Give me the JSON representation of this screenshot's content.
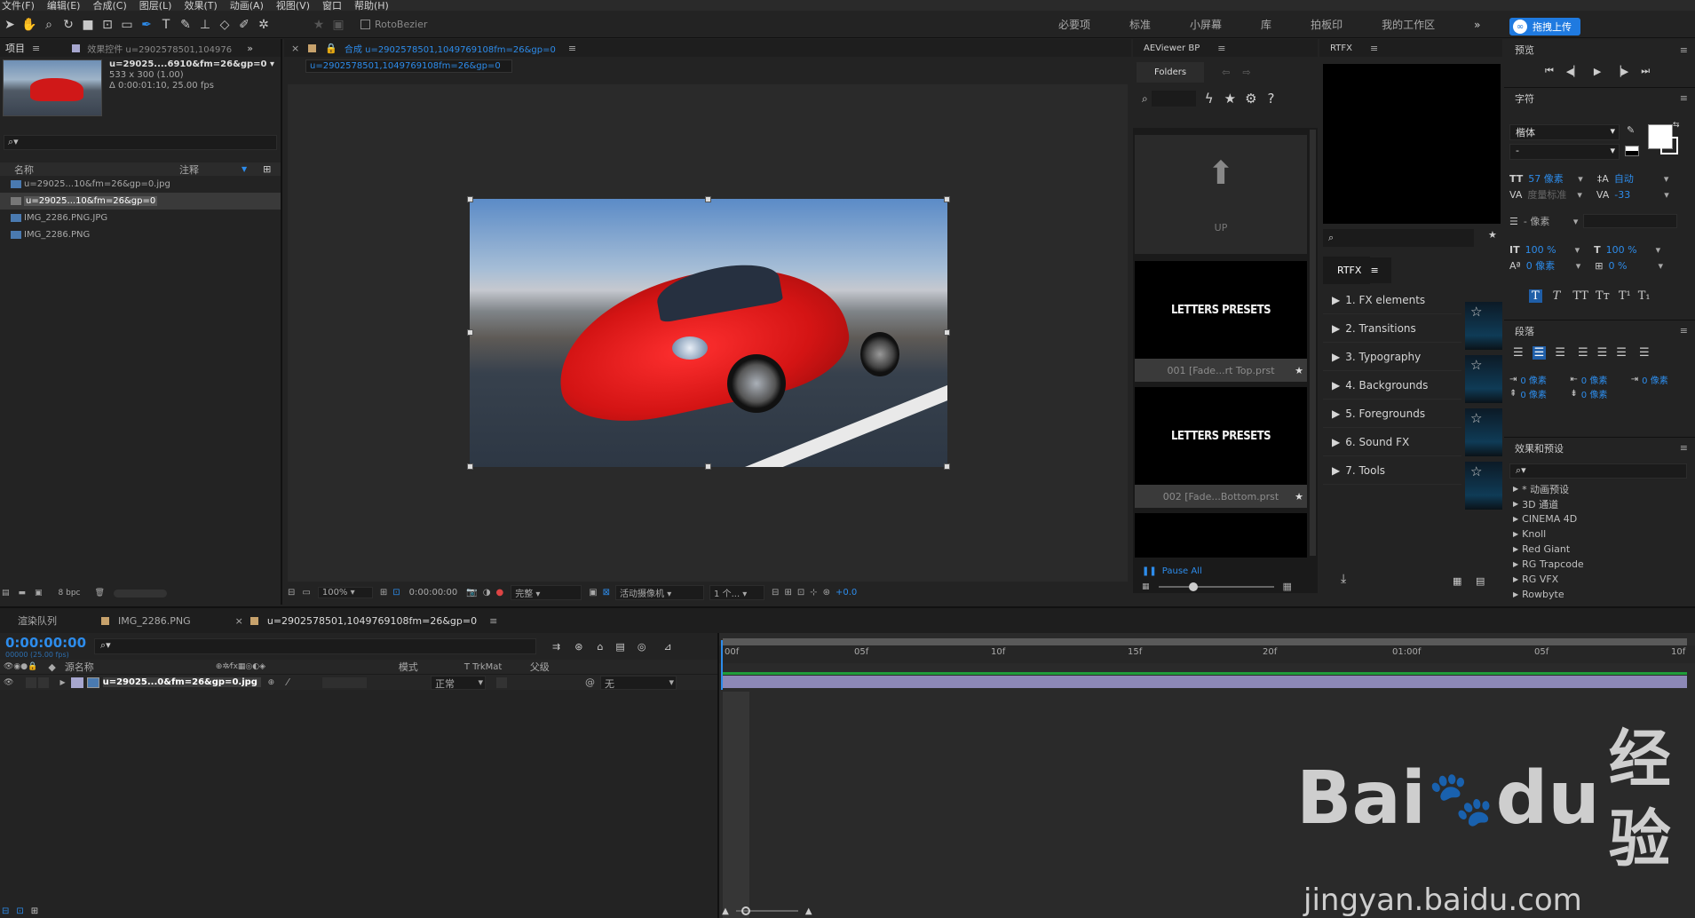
{
  "menu": [
    "文件(F)",
    "编辑(E)",
    "合成(C)",
    "图层(L)",
    "效果(T)",
    "动画(A)",
    "视图(V)",
    "窗口",
    "帮助(H)"
  ],
  "toolbar": {
    "rotobezier": "RotoBezier"
  },
  "workspaces": [
    "必要项",
    "标准",
    "小屏幕",
    "库",
    "拍板印",
    "我的工作区"
  ],
  "upload_badge": "拖拽上传",
  "project_panel": {
    "tab": "项目",
    "effects_tab": "效果控件 u=2902578501,104976",
    "selected_name": "u=29025....6910&fm=26&gp=0 ▾",
    "size": "533 x 300 (1.00)",
    "duration": "Δ 0:00:01:10, 25.00 fps",
    "col_name": "名称",
    "col_comment": "注释",
    "items": [
      "u=29025...10&fm=26&gp=0.jpg",
      "u=29025...10&fm=26&gp=0",
      "IMG_2286.PNG.JPG",
      "IMG_2286.PNG"
    ],
    "bpc": "8 bpc"
  },
  "comp_panel": {
    "tab": "合成 u=2902578501,1049769108fm=26&gp=0",
    "sub_tab": "u=2902578501,1049769108fm=26&gp=0",
    "zoom": "100%",
    "time": "0:00:00:00",
    "quality": "完整",
    "camera": "活动摄像机",
    "views": "1 个...",
    "exposure": "+0.0"
  },
  "aeviewer": {
    "title": "AEViewer BP",
    "folders": "Folders",
    "up": "UP",
    "preset_text": "LETTERS PRESETS",
    "preset1": "001 [Fade...rt Top.prst",
    "preset2": "002 [Fade...Bottom.prst",
    "pause_all": "Pause All"
  },
  "rtfx": {
    "title": "RTFX",
    "tab": "RTFX",
    "items": [
      "1. FX elements",
      "2. Transitions",
      "3. Typography",
      "4. Backgrounds",
      "5. Foregrounds",
      "6. Sound FX",
      "7. Tools"
    ]
  },
  "right_panel": {
    "preview": "预览",
    "char": "字符",
    "font": "楷体",
    "font_style": "-",
    "font_size": "57 像素",
    "leading": "自动",
    "kerning": "度量标准",
    "tracking": "-33",
    "stroke": "- 像素",
    "vscale": "100 %",
    "hscale": "100 %",
    "baseline": "0 像素",
    "tsume": "0 %",
    "para": "段落",
    "indent1": "0 像素",
    "indent2": "0 像素",
    "indent3": "0 像素",
    "space1": "0 像素",
    "space2": "0 像素",
    "effects_title": "效果和预设",
    "effects": [
      "* 动画预设",
      "3D 通道",
      "CINEMA 4D",
      "Knoll",
      "Red Giant",
      "RG Trapcode",
      "RG VFX",
      "Rowbyte"
    ]
  },
  "timeline": {
    "tabs": [
      "渲染队列",
      "IMG_2286.PNG",
      "u=2902578501,1049769108fm=26&gp=0"
    ],
    "timecode": "0:00:00:00",
    "timecode_sub": "00000 (25.00 fps)",
    "col_source": "源名称",
    "col_mode": "模式",
    "col_trkmat": "T  TrkMat",
    "col_parent": "父级",
    "layer_name": "u=29025...0&fm=26&gp=0.jpg",
    "layer_mode": "正常",
    "layer_parent": "无",
    "ruler": [
      "00f",
      "05f",
      "10f",
      "15f",
      "20f",
      "01:00f",
      "05f",
      "10f"
    ]
  },
  "watermark": {
    "brand": "Bai",
    "brand2": "du",
    "brand_cn": "经验",
    "url": "jingyan.baidu.com"
  }
}
